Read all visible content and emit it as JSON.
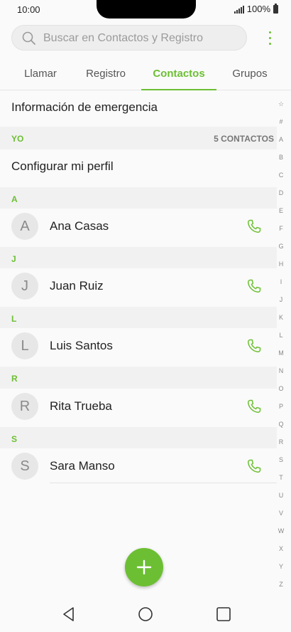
{
  "status": {
    "time": "10:00",
    "battery": "100%"
  },
  "search": {
    "placeholder": "Buscar en Contactos y Registro",
    "value": ""
  },
  "tabs": [
    {
      "label": "Llamar",
      "active": false
    },
    {
      "label": "Registro",
      "active": false
    },
    {
      "label": "Contactos",
      "active": true
    },
    {
      "label": "Grupos",
      "active": false
    }
  ],
  "emergency": {
    "label": "Información de emergencia"
  },
  "me_section": {
    "header": "YO",
    "count": "5 CONTACTOS"
  },
  "profile": {
    "label": "Configurar mi perfil"
  },
  "groups": [
    {
      "letter": "A",
      "contact": {
        "initial": "A",
        "name": "Ana Casas"
      }
    },
    {
      "letter": "J",
      "contact": {
        "initial": "J",
        "name": "Juan Ruiz"
      }
    },
    {
      "letter": "L",
      "contact": {
        "initial": "L",
        "name": "Luis Santos"
      }
    },
    {
      "letter": "R",
      "contact": {
        "initial": "R",
        "name": "Rita Trueba"
      }
    },
    {
      "letter": "S",
      "contact": {
        "initial": "S",
        "name": "Sara Manso"
      }
    }
  ],
  "index": [
    "☆",
    "#",
    "A",
    "B",
    "C",
    "D",
    "E",
    "F",
    "G",
    "H",
    "I",
    "J",
    "K",
    "L",
    "M",
    "N",
    "O",
    "P",
    "Q",
    "R",
    "S",
    "T",
    "U",
    "V",
    "W",
    "X",
    "Y",
    "Z"
  ],
  "icons": {
    "search": "search-icon",
    "more": "more-vertical-icon",
    "call": "phone-icon",
    "add": "plus-icon",
    "back": "back-triangle-icon",
    "home": "home-circle-icon",
    "recents": "recents-square-icon"
  },
  "colors": {
    "accent": "#6cbf33",
    "text": "#222222",
    "muted": "#888888"
  }
}
